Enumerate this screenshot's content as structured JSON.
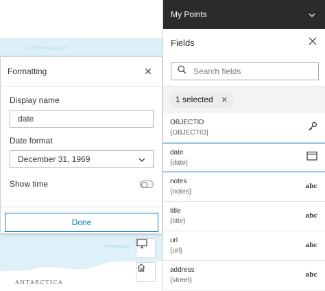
{
  "map": {
    "label": "ANTARCTICA",
    "buttons": [
      {
        "icon": "monitor-icon"
      },
      {
        "icon": "home-icon"
      }
    ]
  },
  "formatting": {
    "title": "Formatting",
    "display_name_label": "Display name",
    "display_name_value": "date",
    "date_format_label": "Date format",
    "date_format_value": "December 31, 1969",
    "show_time_label": "Show time",
    "show_time_enabled": false,
    "done_label": "Done"
  },
  "panel": {
    "topbar_title": "My Points",
    "fields_title": "Fields",
    "search_placeholder": "Search fields",
    "chip_label": "1 selected",
    "rows": [
      {
        "name": "OBJECTID",
        "sub": "{OBJECTID}",
        "icon": "key-icon",
        "selected": false
      },
      {
        "name": "date",
        "sub": "{date}",
        "icon": "calendar-icon",
        "selected": true
      },
      {
        "name": "notes",
        "sub": "{notes}",
        "icon": "abc",
        "selected": false
      },
      {
        "name": "title",
        "sub": "{title}",
        "icon": "abc",
        "selected": false
      },
      {
        "name": "url",
        "sub": "{url}",
        "icon": "abc",
        "selected": false
      },
      {
        "name": "address",
        "sub": "{street}",
        "icon": "abc",
        "selected": false
      }
    ]
  },
  "colors": {
    "accent": "#007ac2",
    "topbar": "#2b2b2b",
    "map_water": "#d7eef7"
  }
}
